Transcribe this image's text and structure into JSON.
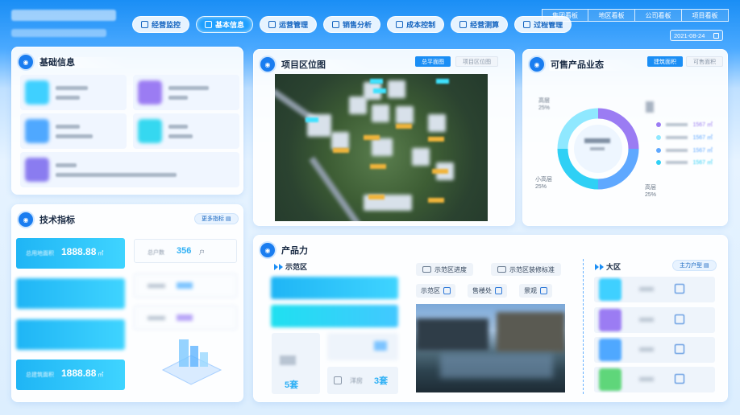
{
  "header": {
    "nav_tabs": [
      {
        "label": "经营监控",
        "active": false
      },
      {
        "label": "基本信息",
        "active": true
      },
      {
        "label": "运营管理",
        "active": false
      },
      {
        "label": "销售分析",
        "active": false
      },
      {
        "label": "成本控制",
        "active": false
      },
      {
        "label": "经营测算",
        "active": false
      },
      {
        "label": "过程管理",
        "active": false
      }
    ],
    "boards": [
      "集团看板",
      "地区看板",
      "公司看板",
      "项目看板"
    ],
    "date": "2021-08-24"
  },
  "basic_info": {
    "title": "基础信息",
    "items": [
      {
        "label": "实体公司",
        "value": "—"
      },
      {
        "label": "项目获取方式",
        "value": "—"
      },
      {
        "label": "",
        "value": ""
      },
      {
        "label": "",
        "value": ""
      },
      {
        "label": "",
        "value": ""
      }
    ]
  },
  "tech": {
    "title": "技术指标",
    "more_label": "更多指标",
    "cards": [
      {
        "label": "总用地面积",
        "value": "1888.88",
        "unit": "㎡"
      },
      {
        "label": "",
        "value": "",
        "unit": ""
      },
      {
        "label": "",
        "value": "",
        "unit": ""
      },
      {
        "label": "总建筑面积",
        "value": "1888.88",
        "unit": "㎡"
      }
    ],
    "stats": [
      {
        "label": "总户数",
        "value": "356",
        "unit": "户"
      }
    ]
  },
  "location": {
    "title": "项目区位图",
    "btn_plan": "总平面图",
    "btn_location": "项目区位图"
  },
  "saleable": {
    "title": "可售产品业态",
    "btn_building": "建筑面积",
    "btn_saleable": "可售面积",
    "donut": [
      {
        "name": "高层",
        "percent": 25,
        "color": "#9b7cf3"
      },
      {
        "name": "洋房",
        "percent": 25,
        "color": "#5fa8ff"
      },
      {
        "name": "小高层",
        "percent": 25,
        "color": "#2fd0f5"
      },
      {
        "name": "",
        "percent": 25,
        "color": "#8fe8ff"
      }
    ],
    "labels": {
      "top_left": "高层\n25%",
      "bottom_left": "小高层\n25%",
      "bottom_right": "洋房\n25%"
    },
    "legend_values": [
      "1567 ㎡",
      "1567 ㎡",
      "1567 ㎡",
      "1567 ㎡"
    ]
  },
  "product": {
    "title": "产品力",
    "demo_label": "示范区",
    "demo_progress": "示范区进度",
    "demo_standard": "示范区装修标准",
    "chips": [
      "示范区",
      "售楼处",
      "景观"
    ],
    "set_label": "样板间总数",
    "set_value": "5套",
    "house_value": "3套",
    "house_label": "洋房",
    "district_label": "大区",
    "main_type_btn": "主力户型"
  }
}
